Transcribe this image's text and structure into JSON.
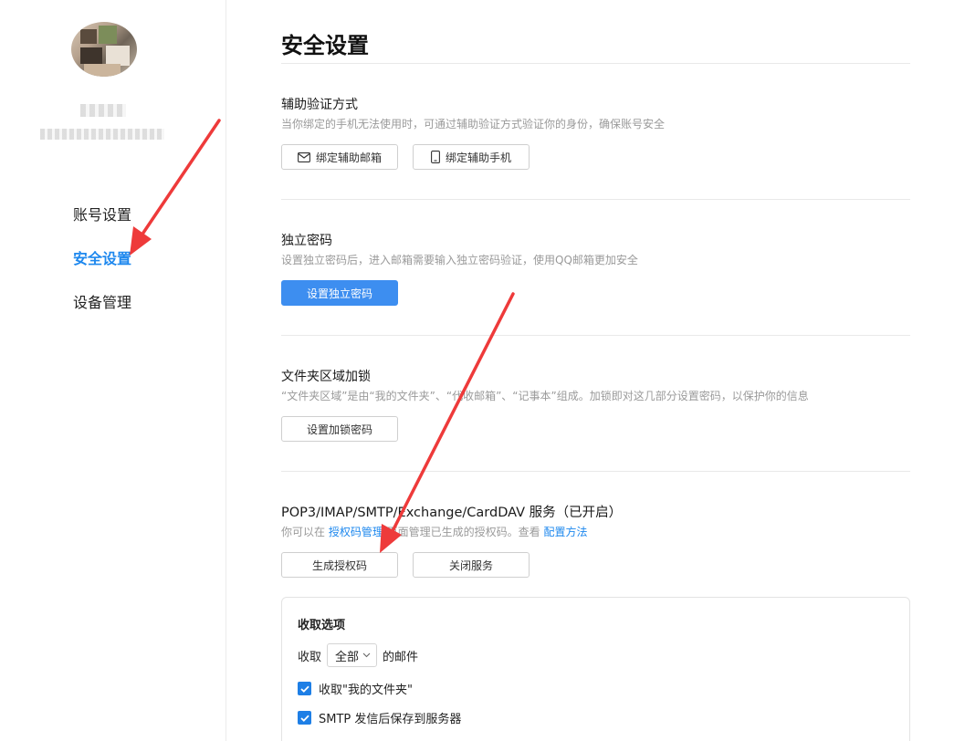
{
  "sidebar": {
    "nav": [
      {
        "label": "账号设置",
        "active": false
      },
      {
        "label": "安全设置",
        "active": true
      },
      {
        "label": "设备管理",
        "active": false
      }
    ]
  },
  "main": {
    "page_title": "安全设置",
    "sections": [
      {
        "title": "辅助验证方式",
        "desc": "当你绑定的手机无法使用时，可通过辅助验证方式验证你的身份，确保账号安全",
        "buttons": [
          {
            "label": "绑定辅助邮箱",
            "icon": "mail-icon"
          },
          {
            "label": "绑定辅助手机",
            "icon": "phone-icon"
          }
        ]
      },
      {
        "title": "独立密码",
        "desc": "设置独立密码后，进入邮箱需要输入独立密码验证，使用QQ邮箱更加安全",
        "buttons": [
          {
            "label": "设置独立密码",
            "primary": true
          }
        ]
      },
      {
        "title": "文件夹区域加锁",
        "desc": "“文件夹区域”是由“我的文件夹”、“代收邮箱”、“记事本”组成。加锁即对这几部分设置密码，以保护你的信息",
        "buttons": [
          {
            "label": "设置加锁密码"
          }
        ]
      },
      {
        "title": "POP3/IMAP/SMTP/Exchange/CardDAV 服务（已开启）",
        "desc_parts": {
          "prefix": "你可以在 ",
          "link1": "授权码管理",
          "middle": " 页面管理已生成的授权码。查看 ",
          "link2": "配置方法"
        },
        "buttons": [
          {
            "label": "生成授权码"
          },
          {
            "label": "关闭服务"
          }
        ]
      }
    ],
    "receive_panel": {
      "title": "收取选项",
      "receive_prefix": "收取",
      "receive_select": "全部",
      "receive_suffix": "的邮件",
      "options": [
        {
          "label": "收取\"我的文件夹\"",
          "checked": true
        },
        {
          "label": "SMTP 发信后保存到服务器",
          "checked": true
        }
      ]
    }
  },
  "colors": {
    "accent": "#1e88ee",
    "primary_button": "#3d8ef0",
    "annotation_arrow": "#ee3a3a"
  }
}
